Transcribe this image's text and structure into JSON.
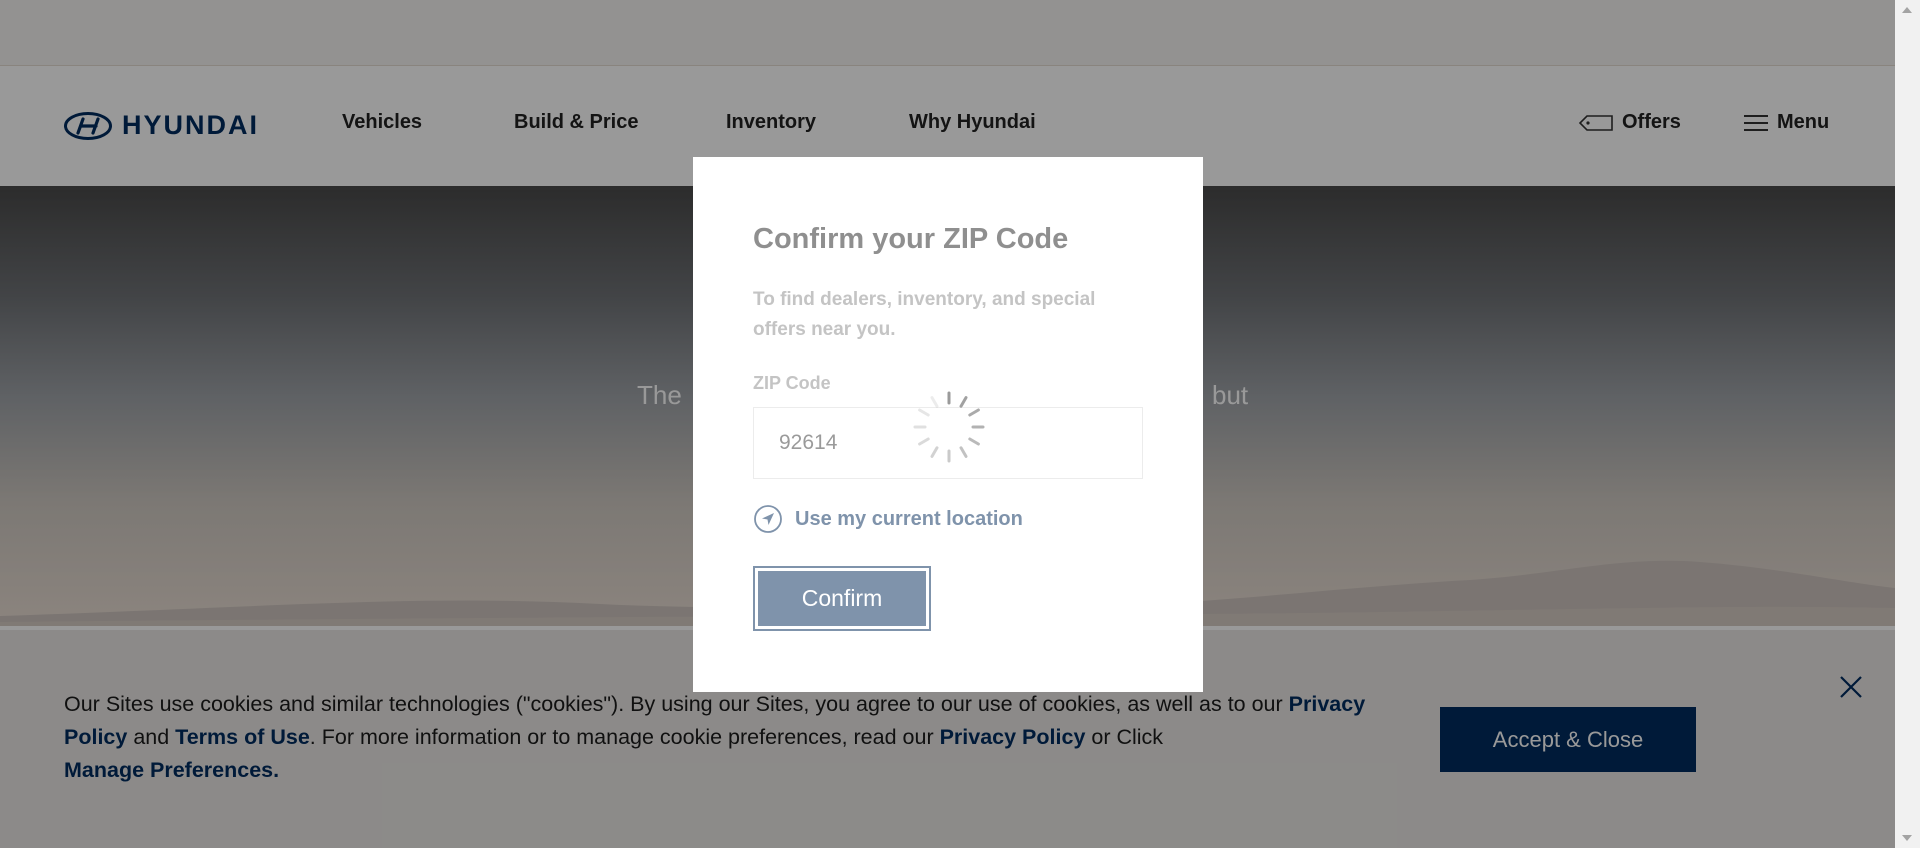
{
  "brand": {
    "logo_text": "HYUNDAI",
    "color": "#002c5f"
  },
  "nav": {
    "items": [
      {
        "label": "Vehicles"
      },
      {
        "label": "Build & Price"
      },
      {
        "label": "Inventory"
      },
      {
        "label": "Why Hyundai"
      }
    ],
    "offers_label": "Offers",
    "menu_label": "Menu"
  },
  "hero": {
    "text_left": "The",
    "text_right": "but"
  },
  "zip_modal": {
    "title": "Confirm your ZIP Code",
    "subtitle": "To find dealers, inventory, and special offers near you.",
    "zip_label": "ZIP Code",
    "zip_value": "92614",
    "location_link": "Use my current location",
    "confirm_label": "Confirm",
    "loading": true
  },
  "cookie_banner": {
    "text_1": "Our Sites use cookies and similar technologies (\"cookies\"). By using our Sites, you agree to our use of cookies, as well as to our ",
    "link_privacy": "Privacy Policy",
    "text_2": " and ",
    "link_terms": "Terms of Use",
    "text_3": ". For more information or to manage cookie preferences, read our ",
    "link_privacy_2": "Privacy Policy",
    "text_4": " or Click ",
    "link_manage": "Manage Preferences.",
    "accept_label": "Accept & Close"
  },
  "colors": {
    "brand_navy": "#002c5f",
    "confirm_button": "#7f93ab",
    "overlay": "rgba(0,0,0,0.4)"
  }
}
